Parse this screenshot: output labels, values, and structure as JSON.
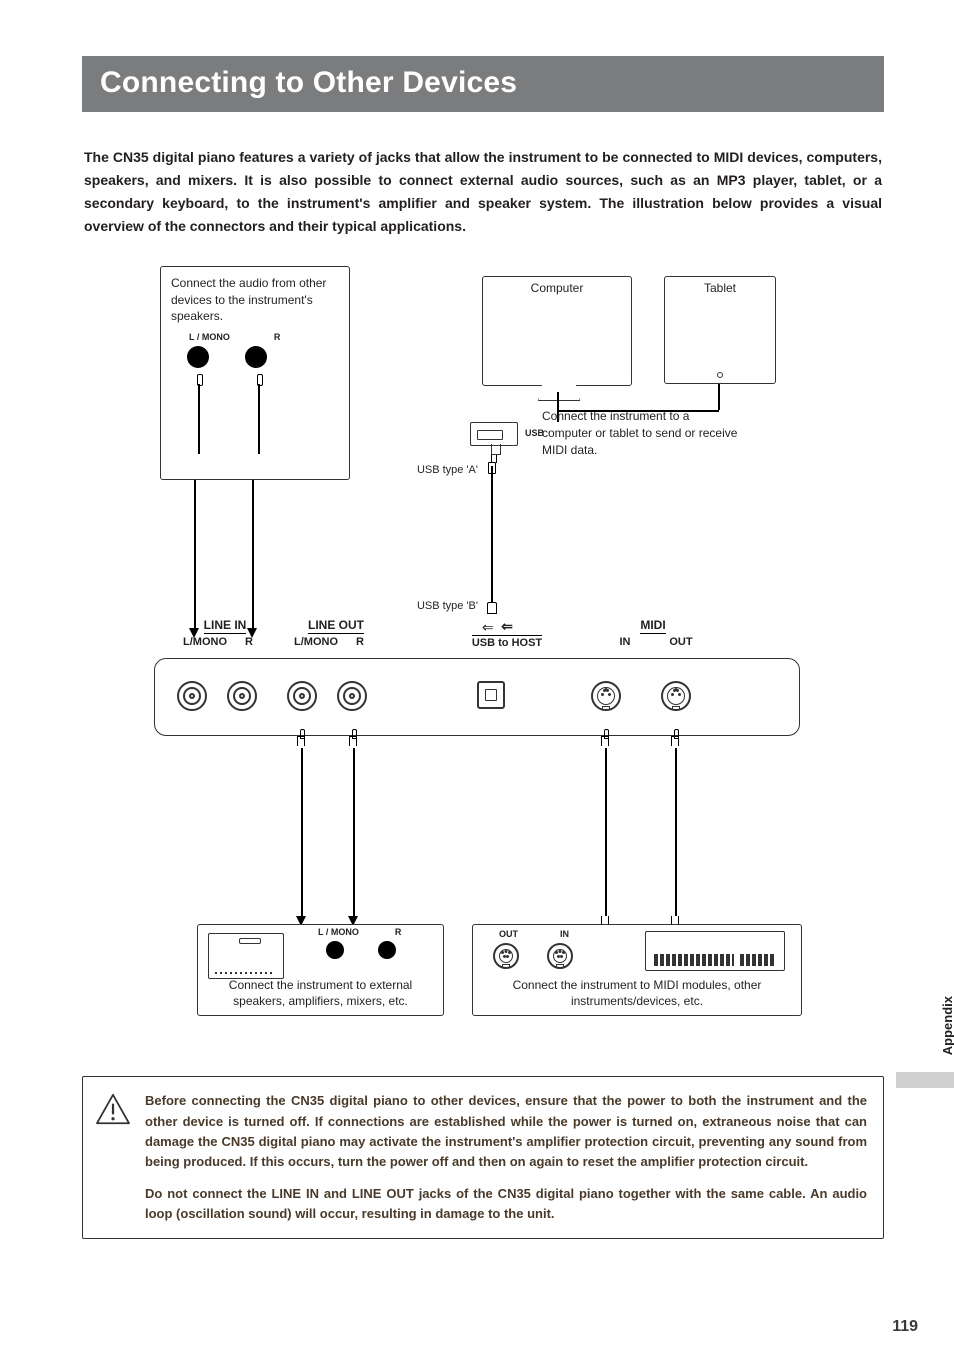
{
  "title": "Connecting to Other Devices",
  "intro": "The CN35 digital piano features a variety of jacks that allow the instrument to be connected to MIDI devices, computers, speakers, and mixers.  It is also possible to connect external audio sources, such as an MP3 player, tablet, or a secondary keyboard, to the instrument's amplifier and speaker system.  The illustration below provides a visual overview of the connectors and their typical applications.",
  "diagram": {
    "linein_box": {
      "text": "Connect the audio from other devices to the instrument's speakers.",
      "l_label": "L / MONO",
      "r_label": "R"
    },
    "computer_label": "Computer",
    "tablet_label": "Tablet",
    "usb_port_label": "USB",
    "usb_desc": "Connect the instrument to a computer or tablet to send or receive MIDI data.",
    "usb_type_a": "USB type 'A'",
    "usb_type_b": "USB type 'B'",
    "panel": {
      "line_in": {
        "title": "LINE IN",
        "l": "L/MONO",
        "r": "R"
      },
      "line_out": {
        "title": "LINE OUT",
        "l": "L/MONO",
        "r": "R"
      },
      "usb": {
        "title": "USB to HOST"
      },
      "midi": {
        "title": "MIDI",
        "in": "IN",
        "out": "OUT"
      }
    },
    "speaker_box": {
      "l_label": "L / MONO",
      "r_label": "R",
      "text": "Connect the instrument to external speakers, amplifiers, mixers, etc."
    },
    "midi_box": {
      "out_label": "OUT",
      "in_label": "IN",
      "text": "Connect the instrument to MIDI modules, other instruments/devices, etc."
    }
  },
  "warning": {
    "p1": "Before connecting the CN35 digital piano to other devices, ensure that the power to both the instrument and the other device is turned off.  If connections are established while the power is turned on, extraneous noise that can damage the CN35 digital piano may activate the instrument's amplifier protection circuit, preventing any sound from being produced. If this occurs, turn the power off and then on again to reset the amplifier protection circuit.",
    "p2": "Do not connect the LINE IN and LINE OUT jacks of the CN35 digital piano together with the same cable.  An audio loop (oscillation sound) will occur, resulting in damage to the unit."
  },
  "side_tab": "Appendix",
  "page_number": "119"
}
